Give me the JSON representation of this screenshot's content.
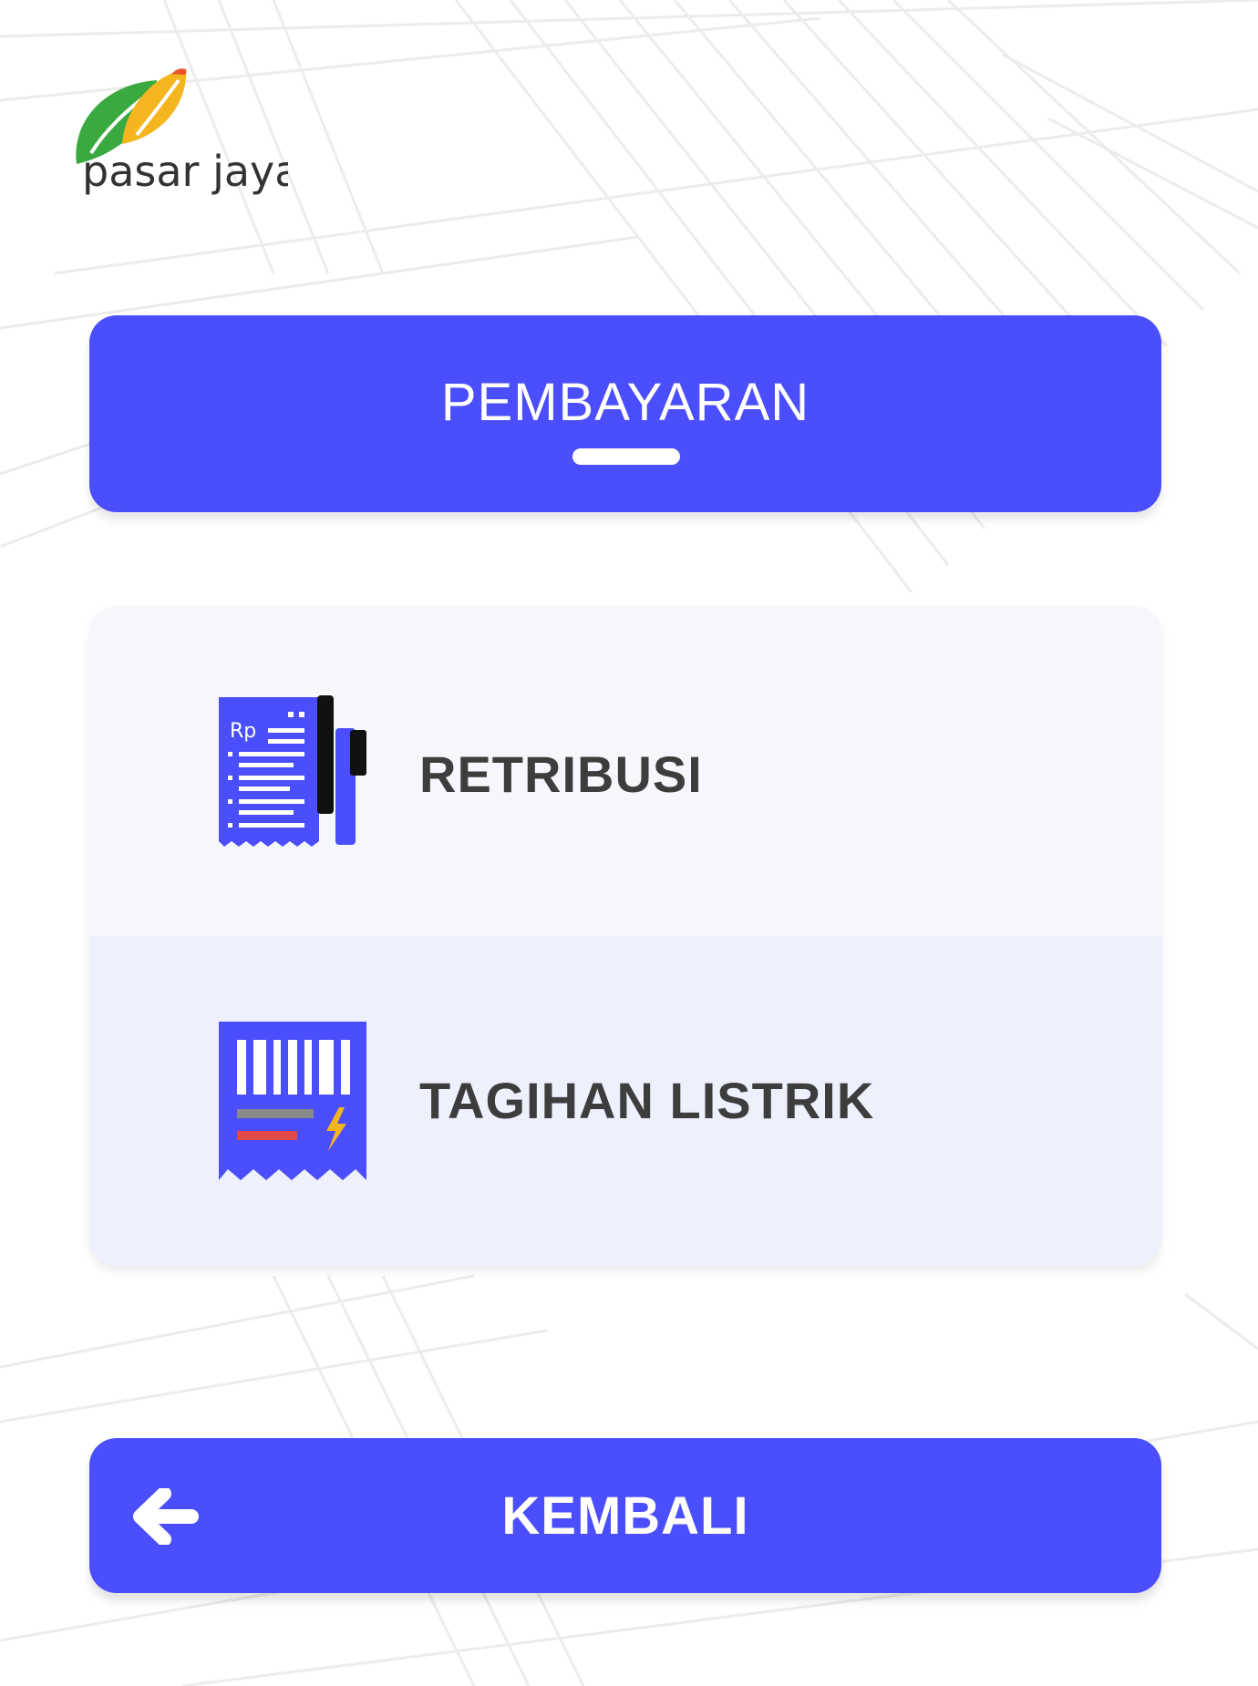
{
  "logo": {
    "text": "pasar jaya"
  },
  "header": {
    "title": "PEMBAYARAN"
  },
  "menu": {
    "items": [
      {
        "label": "RETRIBUSI",
        "icon": "receipt-rp-icon"
      },
      {
        "label": "TAGIHAN LISTRIK",
        "icon": "electricity-bill-icon"
      }
    ],
    "receipt_icon_text": "Rp"
  },
  "footer": {
    "back_label": "KEMBALI",
    "back_icon": "arrow-left-icon"
  },
  "colors": {
    "accent": "#4b4efc",
    "item_bg_1": "#f6f7fd",
    "item_bg_2": "#eef0fd",
    "label_text": "#3d3d3d",
    "logo_green": "#3aa93f",
    "logo_orange": "#f39c12"
  }
}
